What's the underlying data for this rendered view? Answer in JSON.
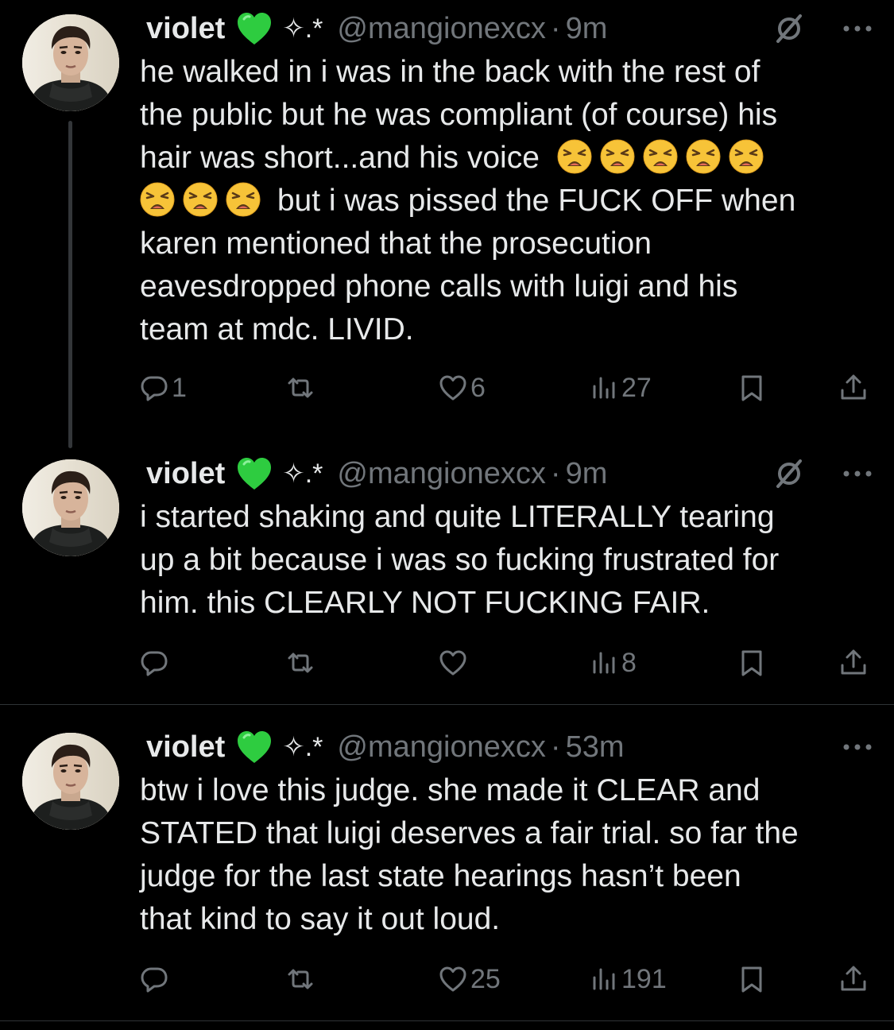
{
  "tweets": [
    {
      "name": "violet",
      "sparkle": "✧.*",
      "handle": "@mangionexcx",
      "dot": "·",
      "time": "9m",
      "lines": [
        "he walked in i was in the back with the rest of",
        "the public but he was compliant (of course) his",
        "hair was short...and his voice",
        "but i was pissed the FUCK OFF when",
        "karen mentioned that the prosecution",
        "eavesdropped phone calls with luigi and his",
        "team at mdc. LIVID."
      ],
      "replies": "1",
      "retweets": "",
      "likes": "6",
      "views": "27"
    },
    {
      "name": "violet",
      "sparkle": "✧.*",
      "handle": "@mangionexcx",
      "dot": "·",
      "time": "9m",
      "lines": [
        "i started shaking and quite LITERALLY tearing",
        "up a bit because i was so fucking frustrated for",
        "him. this CLEARLY NOT FUCKING FAIR."
      ],
      "replies": "",
      "retweets": "",
      "likes": "",
      "views": "8"
    },
    {
      "name": "violet",
      "sparkle": "✧.*",
      "handle": "@mangionexcx",
      "dot": "·",
      "time": "53m",
      "lines": [
        "btw i love this judge. she made it CLEAR and",
        "STATED that luigi deserves a fair trial. so far the",
        "judge for the last state hearings hasn’t been",
        "that kind to say it out loud."
      ],
      "replies": "",
      "retweets": "",
      "likes": "25",
      "views": "191"
    }
  ],
  "icons": {
    "verified_emoji": "green-heart-icon",
    "weary_emoji": "weary-face-icon",
    "grok": "grok-icon",
    "more": "more-options-icon",
    "reply": "reply-icon",
    "retweet": "retweet-icon",
    "like": "like-icon",
    "views": "views-icon",
    "bookmark": "bookmark-icon",
    "share": "share-icon"
  },
  "colors": {
    "background": "#000000",
    "text": "#e7e9ea",
    "muted": "#71767b",
    "heart_green": "#2ecc40",
    "emoji_yellow": "#f7c338"
  }
}
